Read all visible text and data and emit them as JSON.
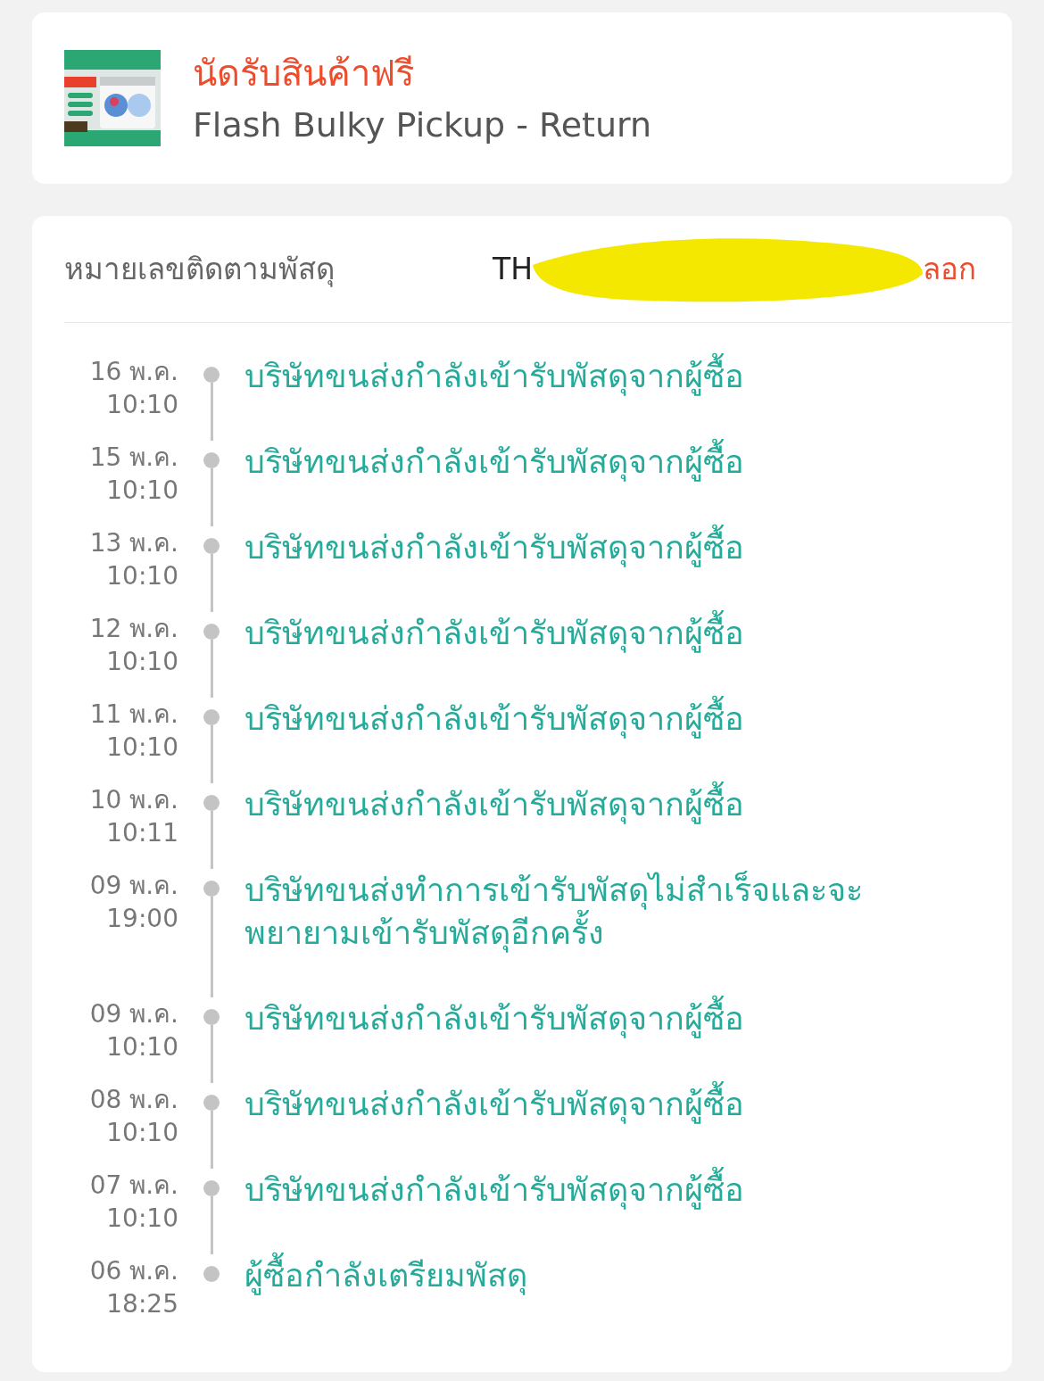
{
  "product": {
    "title": "นัดรับสินค้าฟรี",
    "subtitle": "Flash Bulky Pickup - Return"
  },
  "tracking": {
    "label": "หมายเลขติดตามพัสดุ",
    "number": "TH",
    "copy_link": "ลอก"
  },
  "timeline": [
    {
      "date": "16 พ.ค.",
      "time": "10:10",
      "text": "บริษัทขนส่งกำลังเข้ารับพัสดุจากผู้ซื้อ"
    },
    {
      "date": "15 พ.ค.",
      "time": "10:10",
      "text": "บริษัทขนส่งกำลังเข้ารับพัสดุจากผู้ซื้อ"
    },
    {
      "date": "13 พ.ค.",
      "time": "10:10",
      "text": "บริษัทขนส่งกำลังเข้ารับพัสดุจากผู้ซื้อ"
    },
    {
      "date": "12 พ.ค.",
      "time": "10:10",
      "text": "บริษัทขนส่งกำลังเข้ารับพัสดุจากผู้ซื้อ"
    },
    {
      "date": "11 พ.ค.",
      "time": "10:10",
      "text": "บริษัทขนส่งกำลังเข้ารับพัสดุจากผู้ซื้อ"
    },
    {
      "date": "10 พ.ค.",
      "time": "10:11",
      "text": "บริษัทขนส่งกำลังเข้ารับพัสดุจากผู้ซื้อ"
    },
    {
      "date": "09 พ.ค.",
      "time": "19:00",
      "text": "บริษัทขนส่งทำการเข้ารับพัสดุไม่สำเร็จและจะพยายามเข้ารับพัสดุอีกครั้ง"
    },
    {
      "date": "09 พ.ค.",
      "time": "10:10",
      "text": "บริษัทขนส่งกำลังเข้ารับพัสดุจากผู้ซื้อ"
    },
    {
      "date": "08 พ.ค.",
      "time": "10:10",
      "text": "บริษัทขนส่งกำลังเข้ารับพัสดุจากผู้ซื้อ"
    },
    {
      "date": "07 พ.ค.",
      "time": "10:10",
      "text": "บริษัทขนส่งกำลังเข้ารับพัสดุจากผู้ซื้อ"
    },
    {
      "date": "06 พ.ค.",
      "time": "18:25",
      "text": "ผู้ซื้อกำลังเตรียมพัสดุ"
    }
  ]
}
